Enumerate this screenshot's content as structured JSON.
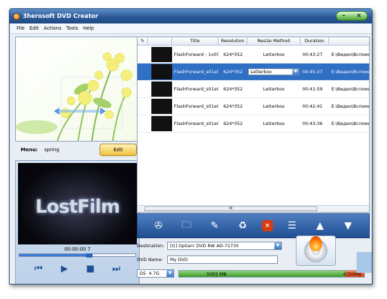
{
  "window": {
    "title": "3herosoft DVD Creator"
  },
  "menu": {
    "items": [
      "File",
      "Edit",
      "Actions",
      "Tools",
      "Help"
    ]
  },
  "left": {
    "menu_label": "Menu:",
    "menu_value": "spring",
    "edit_label": "Edit"
  },
  "player": {
    "overlay_text": "LostFilm",
    "time": "00:00:00 7",
    "progress_percent": 60,
    "controls": [
      "skip-back-icon",
      "play-icon",
      "stop-icon",
      "skip-forward-icon"
    ]
  },
  "table": {
    "headers": [
      "",
      "Title",
      "Resolution",
      "Resize Method",
      "Duration",
      ""
    ],
    "rows": [
      {
        "title": "FlashForward - 1x05",
        "resolution": "624*352",
        "resize": "Letterbox",
        "duration": "00:43:27",
        "path": "E:\\Видео\\Вспомн",
        "selected": false
      },
      {
        "title": "FlashForward_s01e0",
        "resolution": "624*352",
        "resize": "Letterbox",
        "duration": "00:45:27",
        "path": "E:\\Видео\\Вспомн",
        "selected": true
      },
      {
        "title": "FlashForward_s01e0",
        "resolution": "624*352",
        "resize": "Letterbox",
        "duration": "00:41:59",
        "path": "E:\\Видео\\Вспомн",
        "selected": false
      },
      {
        "title": "FlashForward_s01e0",
        "resolution": "624*352",
        "resize": "Letterbox",
        "duration": "00:42:41",
        "path": "E:\\Видео\\Вспомн",
        "selected": false
      },
      {
        "title": "FlashForward_s01e0",
        "resolution": "624*352",
        "resize": "Letterbox",
        "duration": "00:43:36",
        "path": "E:\\Видео\\Вспомн",
        "selected": false
      }
    ],
    "scroll_grip": "III"
  },
  "toolbar": {
    "buttons": [
      "film-reel-icon",
      "add-folder-icon",
      "edit-clip-icon",
      "recycle-bin-icon",
      "delete-icon",
      "list-icon",
      "move-up-icon",
      "move-down-icon"
    ]
  },
  "destination": {
    "label": "Destination:",
    "value": "[G] Optiarc DVD RW AD-71735"
  },
  "dvd_name": {
    "label": "DVD Name:",
    "value": "My DVD"
  },
  "size": {
    "type": "D5",
    "capacity": "4.7G",
    "used": "5055 MB",
    "limit": "4700MB",
    "used_fraction": 0.9
  },
  "colors": {
    "titlebar": "#2b5a98",
    "selection": "#2f6fc4",
    "progress": "#3c9a2a",
    "over_limit": "#d83a10"
  }
}
